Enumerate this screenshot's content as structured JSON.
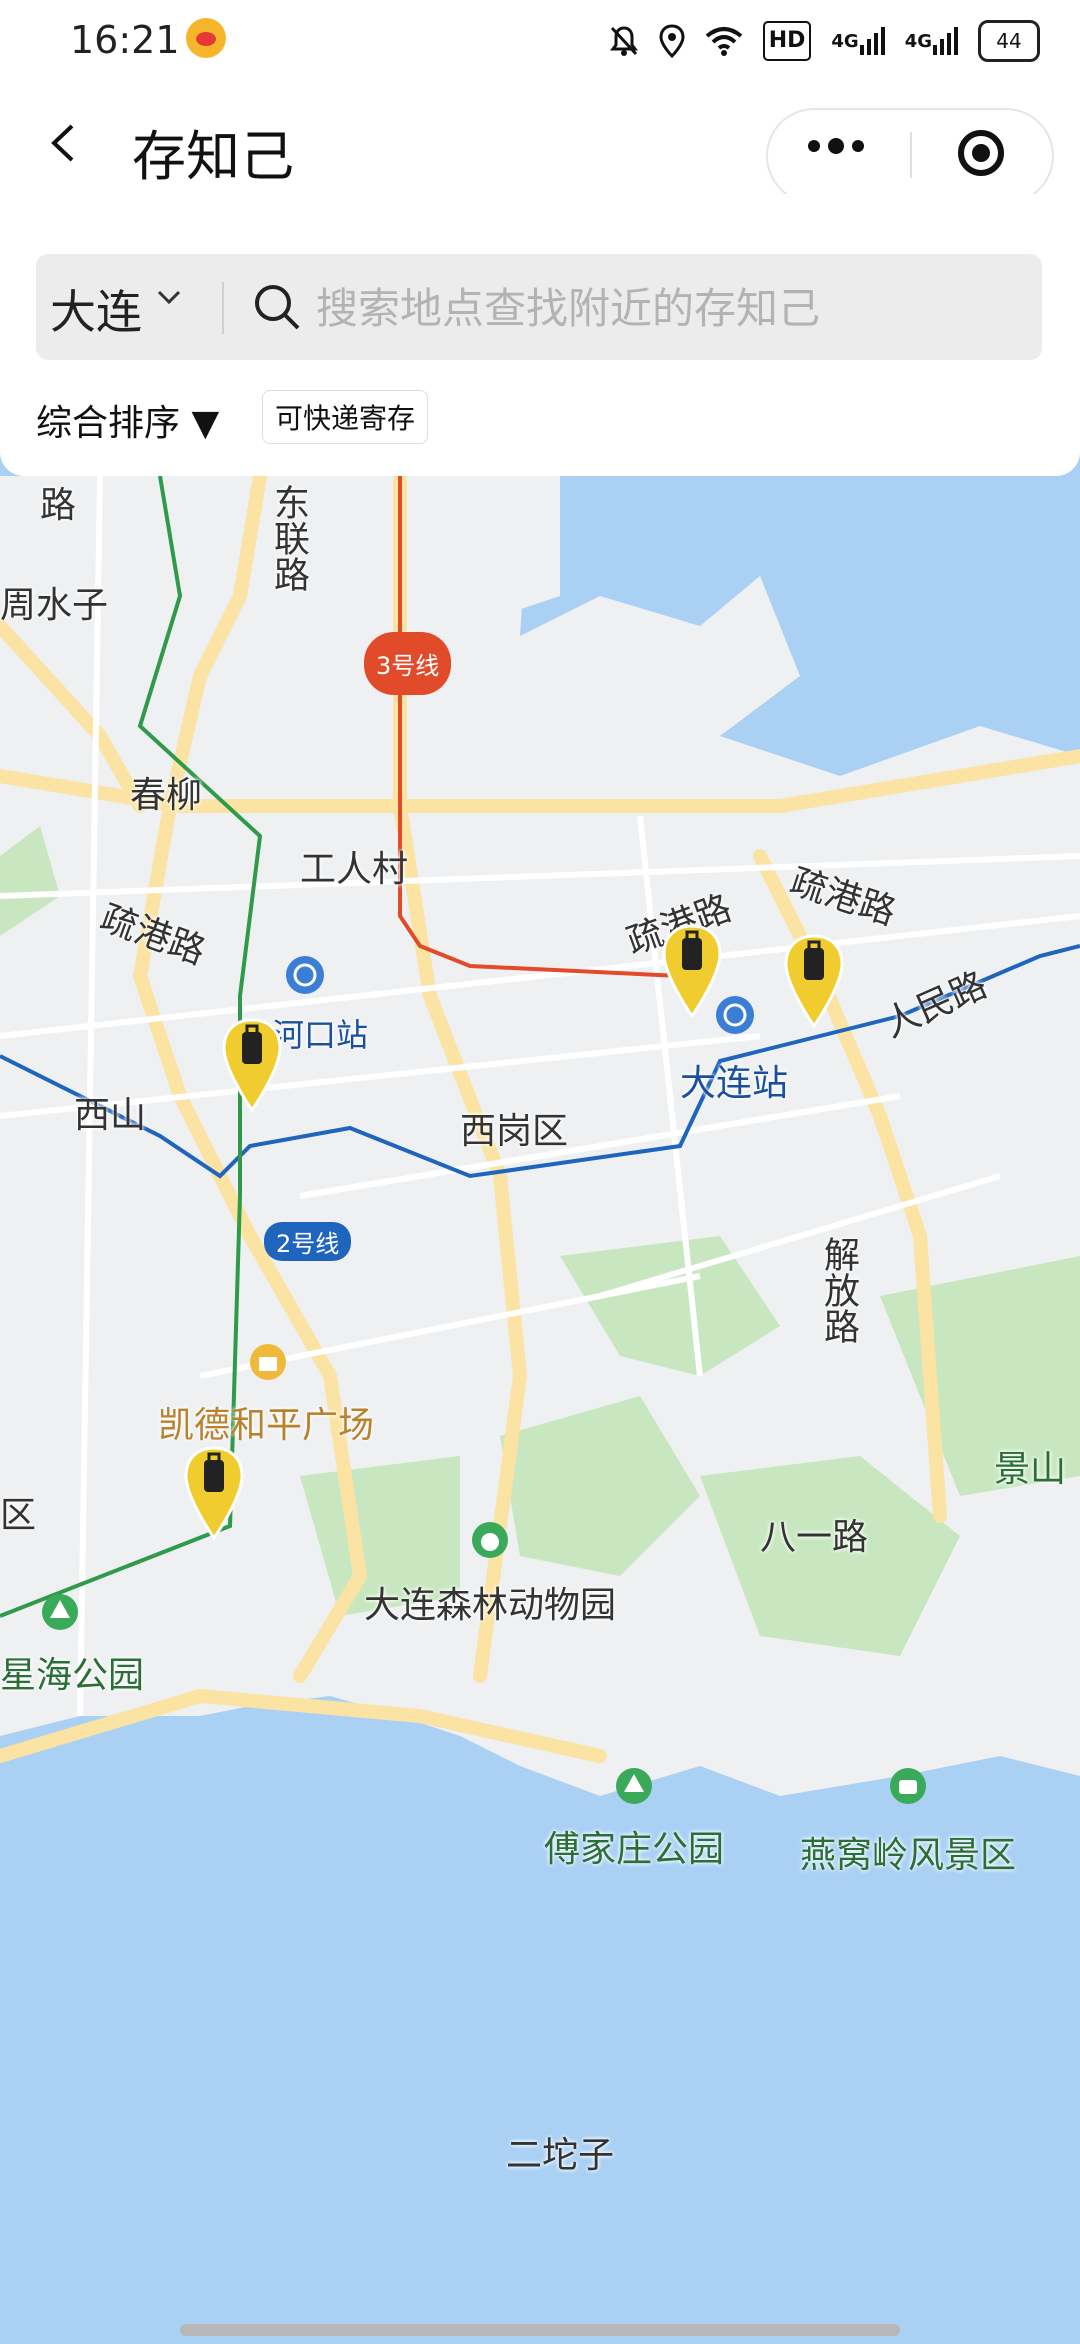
{
  "status_bar": {
    "time": "16:21",
    "battery": "44",
    "network_hd": "HD",
    "signal_1": "4G",
    "signal_2": "4G"
  },
  "header": {
    "title": "存知己"
  },
  "search": {
    "city": "大连",
    "placeholder": "搜索地点查找附近的存知己"
  },
  "filters": {
    "sort_label": "综合排序 ▼",
    "chip_label": "可快递寄存"
  },
  "map": {
    "labels": {
      "road_top_left": "路",
      "dongliang_road": "东联路",
      "zhoushuizi": "周水子",
      "chunliu": "春柳",
      "gongrencun": "工人村",
      "shugang_road_left": "疏港路",
      "shugang_road_center": "疏港路",
      "shugang_road_right": "疏港路",
      "renmin_road": "人民路",
      "shahekou_station": "沙河口站",
      "xishan": "西山",
      "xigang_district": "西岗区",
      "dalian_station": "大连站",
      "jiefang_road": "解放路",
      "kaide_plaza": "凯德和平广场",
      "district_edge": "区",
      "jingshan": "景山",
      "bayi_road": "八一路",
      "forest_zoo": "大连森林动物园",
      "xinghai_park": "星海公园",
      "fujiazhuang_park": "傅家庄公园",
      "yanwoling": "燕窝岭风景区",
      "ertuozi": "二坨子"
    },
    "metro": {
      "line3": "3号线",
      "line2": "2号线"
    },
    "colors": {
      "sea": "#aad1f4",
      "land": "#eef0f2",
      "green": "#c8e7c0",
      "road_major": "#fbe3a3",
      "line2": "#1f64bd",
      "line3": "#e24b2a",
      "pin": "#f0cc2e"
    }
  }
}
